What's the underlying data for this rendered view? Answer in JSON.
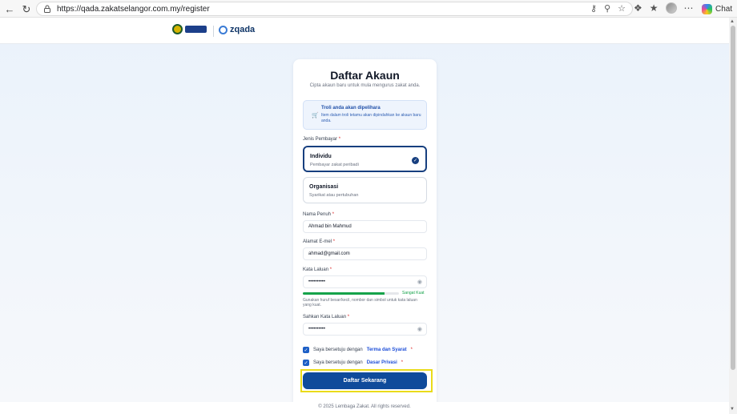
{
  "browser": {
    "url": "https://qada.zakatselangor.com.my/register",
    "chat_label": "Chat"
  },
  "header": {
    "brand_name": "zqada"
  },
  "card": {
    "title": "Daftar Akaun",
    "subtitle": "Cipta akaun baru untuk mula mengurus zakat anda.",
    "notice": {
      "title": "Troli anda akan dipelihara",
      "body": "Item dalam troli tetamu akan dipindahkan ke akaun baru anda."
    },
    "payer_type": {
      "label": "Jenis Pembayar",
      "options": [
        {
          "title": "Individu",
          "subtitle": "Pembayar zakat peribadi",
          "selected": true
        },
        {
          "title": "Organisasi",
          "subtitle": "Syarikat atau pertubuhan",
          "selected": false
        }
      ]
    },
    "full_name": {
      "label": "Nama Penuh",
      "value": "Ahmad bin Mahmud"
    },
    "email": {
      "label": "Alamat E-mel",
      "value": "ahmad@gmail.com"
    },
    "password": {
      "label": "Kata Laluan",
      "value": "••••••••••",
      "strength_label": "Sangat Kuat",
      "strength": 0.85,
      "hint": "Gunakan huruf besar/kecil, nombor dan simbol untuk kata laluan yang kuat."
    },
    "confirm_password": {
      "label": "Sahkan Kata Laluan",
      "value": "••••••••••"
    },
    "terms": {
      "prefix": "Saya bersetuju dengan",
      "link": "Terma dan Syarat",
      "checked": true
    },
    "privacy": {
      "prefix": "Saya bersetuju dengan",
      "link": "Dasar Privasi",
      "checked": true
    },
    "submit_label": "Daftar Sekarang"
  },
  "footer": {
    "text": "© 2025 Lembaga Zakat. All rights reserved."
  },
  "colors": {
    "primary": "#0f4b9b",
    "accent_link": "#1d4ed8",
    "success": "#16a34a",
    "required": "#dc2626",
    "highlight": "#eadb1a"
  }
}
